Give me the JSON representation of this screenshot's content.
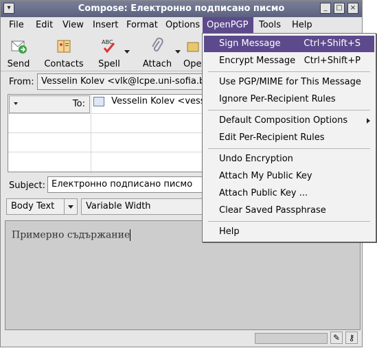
{
  "window": {
    "title": "Compose: Електронно подписано писмо"
  },
  "menubar": {
    "items": [
      "File",
      "Edit",
      "View",
      "Insert",
      "Format",
      "Options",
      "OpenPGP",
      "Tools",
      "Help"
    ]
  },
  "toolbar": {
    "send": "Send",
    "contacts": "Contacts",
    "spell": "Spell",
    "attach": "Attach",
    "open": "Ope"
  },
  "from": {
    "label": "From:",
    "value": "Vesselin Kolev <vlk@lcpe.uni-sofia.bg>"
  },
  "recipients": {
    "type": "To:",
    "value": "Vesselin Kolev <vesso"
  },
  "subject": {
    "label": "Subject:",
    "value": "Електронно подписано писмо"
  },
  "format": {
    "style": "Body Text",
    "font": "Variable Width"
  },
  "body": {
    "text": "Примерно съдържание"
  },
  "openpgp_menu": {
    "sign": {
      "label": "Sign Message",
      "shortcut": "Ctrl+Shift+S"
    },
    "encrypt": {
      "label": "Encrypt Message",
      "shortcut": "Ctrl+Shift+P"
    },
    "pgpmime": "Use PGP/MIME for This Message",
    "ignore_rules": "Ignore Per-Recipient Rules",
    "default_options": "Default Composition Options",
    "edit_rules": "Edit Per-Recipient Rules",
    "undo": "Undo Encryption",
    "attach_my_key": "Attach My Public Key",
    "attach_key": "Attach Public Key ...",
    "clear_pass": "Clear Saved Passphrase",
    "help": "Help"
  },
  "colors": {
    "accent": "#5d4a8c",
    "titlebar": "#6b7090"
  }
}
